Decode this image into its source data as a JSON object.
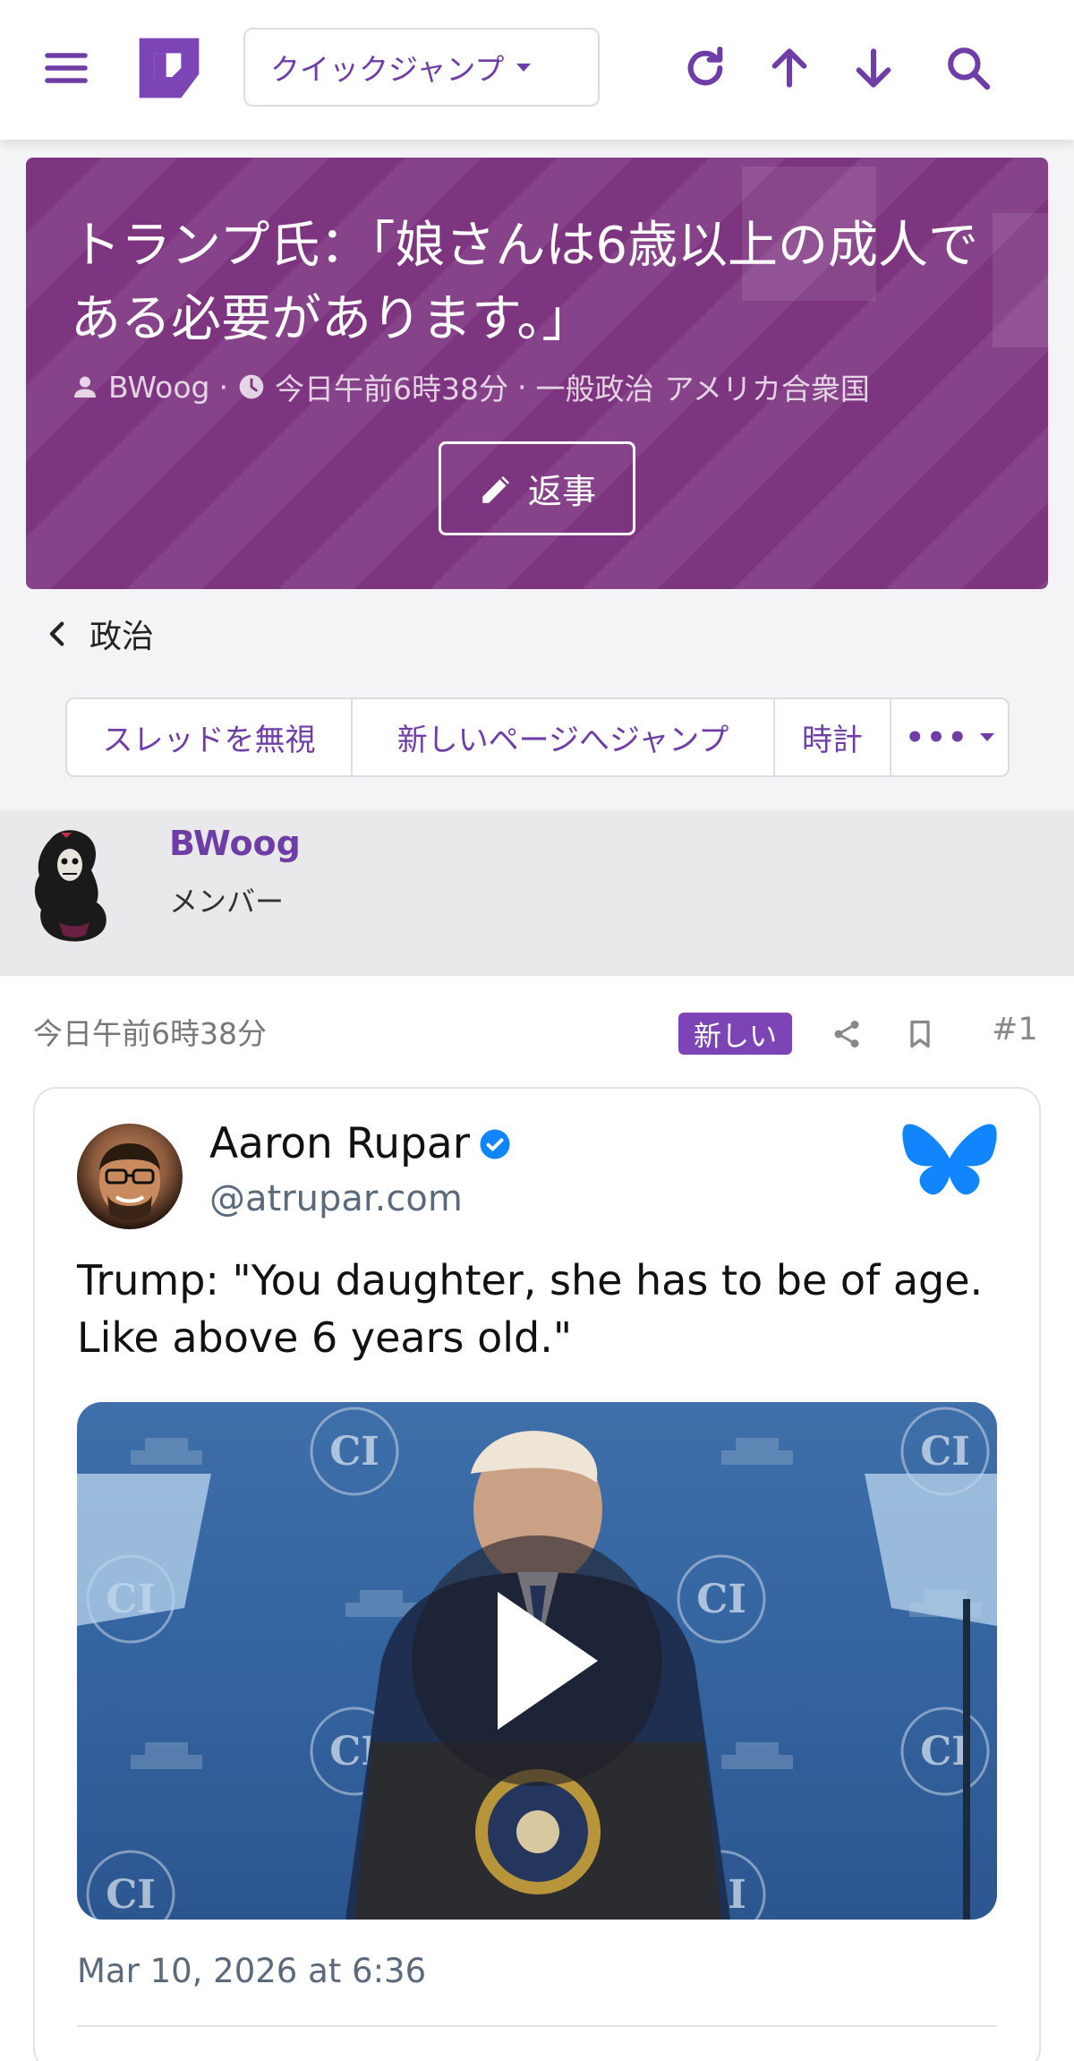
{
  "topbar": {
    "quick_jump_label": "クイックジャンプ",
    "icons": [
      "menu-icon",
      "forum-logo-icon",
      "refresh-icon",
      "arrow-up-icon",
      "arrow-down-icon",
      "search-icon"
    ]
  },
  "thread": {
    "title": "トランプ氏：「娘さんは6歳以上の成人である必要があります。」",
    "author": "BWoog",
    "time": "今日午前6時38分",
    "forum": "一般政治",
    "prefix": "アメリカ合衆国",
    "reply_label": "返事"
  },
  "breadcrumb": {
    "label": "政治"
  },
  "actions": [
    {
      "label": "スレッドを無視"
    },
    {
      "label": "新しいページへジャンプ"
    },
    {
      "label": "時計"
    },
    {
      "label": "•••"
    }
  ],
  "user": {
    "name": "BWoog",
    "role": "メンバー"
  },
  "post": {
    "time": "今日午前6時38分",
    "badge": "新しい",
    "number": "#1"
  },
  "embed": {
    "name": "Aaron Rupar",
    "handle": "@atrupar.com",
    "text": "Trump: \"You daughter, she has to be of age. Like above 6 years old.\"",
    "date": "Mar 10, 2026 at 6:36",
    "video_logo": "CI"
  },
  "colors": {
    "accent": "#6e3ea6",
    "banner": "#7e3580",
    "badge": "#7d44b5",
    "bluesky": "#1185fe"
  }
}
